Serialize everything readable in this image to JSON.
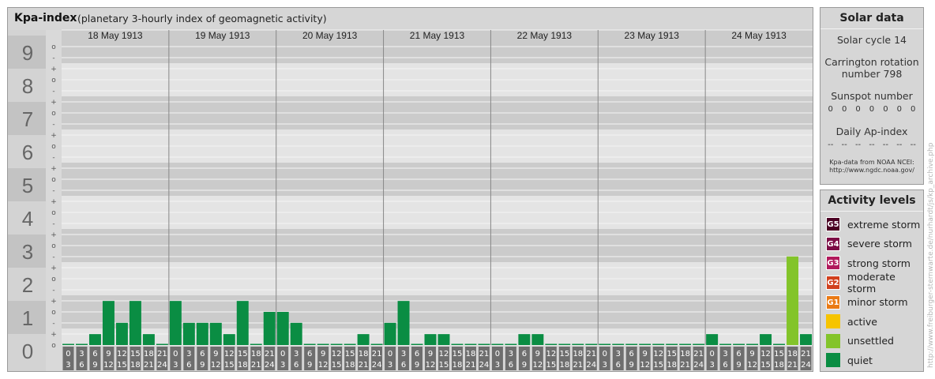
{
  "header": {
    "title": "Kpa-index",
    "subtitle": "(planetary 3-hourly index of geomagnetic activity)"
  },
  "chart_data": {
    "type": "bar",
    "y_levels": [
      "0",
      "1",
      "2",
      "3",
      "4",
      "5",
      "6",
      "7",
      "8",
      "9"
    ],
    "y_sublevels": [
      "o",
      "+",
      "-",
      "o",
      "+",
      "-",
      "o",
      "+",
      "-",
      "o",
      "+",
      "-",
      "o",
      "+",
      "-",
      "o",
      "+",
      "-",
      "o",
      "+",
      "-",
      "o",
      "+",
      "-",
      "o",
      "+",
      "-",
      "o"
    ],
    "ylim": [
      0,
      9
    ],
    "days": [
      "18 May 1913",
      "19 May 1913",
      "20 May 1913",
      "21 May 1913",
      "22 May 1913",
      "23 May 1913",
      "24 May 1913"
    ],
    "interval_labels": [
      [
        "0",
        "3"
      ],
      [
        "3",
        "6"
      ],
      [
        "6",
        "9"
      ],
      [
        "9",
        "12"
      ],
      [
        "12",
        "15"
      ],
      [
        "15",
        "18"
      ],
      [
        "18",
        "21"
      ],
      [
        "21",
        "24"
      ]
    ],
    "values": [
      [
        0,
        0,
        0.33,
        1.33,
        0.67,
        1.33,
        0.33,
        0
      ],
      [
        1.33,
        0.67,
        0.67,
        0.67,
        0.33,
        1.33,
        0,
        1
      ],
      [
        1,
        0.67,
        0,
        0,
        0,
        0,
        0.33,
        0
      ],
      [
        0.67,
        1.33,
        0,
        0.33,
        0.33,
        0,
        0,
        0
      ],
      [
        0,
        0,
        0.33,
        0.33,
        0,
        0,
        0,
        0
      ],
      [
        0,
        0,
        0,
        0,
        0,
        0,
        0,
        0
      ],
      [
        0.33,
        0,
        0,
        0,
        0.33,
        0,
        2.67,
        0.33
      ]
    ],
    "colors": {
      "quiet": "#0a8d43",
      "unsettled": "#83c42a"
    }
  },
  "solar": {
    "heading": "Solar data",
    "cycle": "Solar cycle 14",
    "carrington_line1": "Carrington rotation",
    "carrington_line2": "number 798",
    "sunspot_heading": "Sunspot number",
    "sunspot_values": [
      "0",
      "0",
      "0",
      "0",
      "0",
      "0",
      "0"
    ],
    "ap_heading": "Daily Ap-index",
    "ap_values": [
      "--",
      "--",
      "--",
      "--",
      "--",
      "--",
      "--"
    ],
    "credit_line1": "Kpa-data from NOAA NCEI:",
    "credit_line2": "http://www.ngdc.noaa.gov/"
  },
  "activity": {
    "heading": "Activity levels",
    "levels": [
      {
        "badge": "G5",
        "label": "extreme storm",
        "color": "#4a0022"
      },
      {
        "badge": "G4",
        "label": "severe storm",
        "color": "#7c0c45"
      },
      {
        "badge": "G3",
        "label": "strong storm",
        "color": "#b1195c"
      },
      {
        "badge": "G2",
        "label": "moderate storm",
        "color": "#d1411e"
      },
      {
        "badge": "G1",
        "label": "minor storm",
        "color": "#ea7a14"
      },
      {
        "badge": "",
        "label": "active",
        "color": "#f6c400"
      },
      {
        "badge": "",
        "label": "unsettled",
        "color": "#83c42a"
      },
      {
        "badge": "",
        "label": "quiet",
        "color": "#0a8d43"
      }
    ]
  },
  "credit_vertical": "http://www.freiburger-sternwarte.de/nurhardt/js/kp_archive.php"
}
